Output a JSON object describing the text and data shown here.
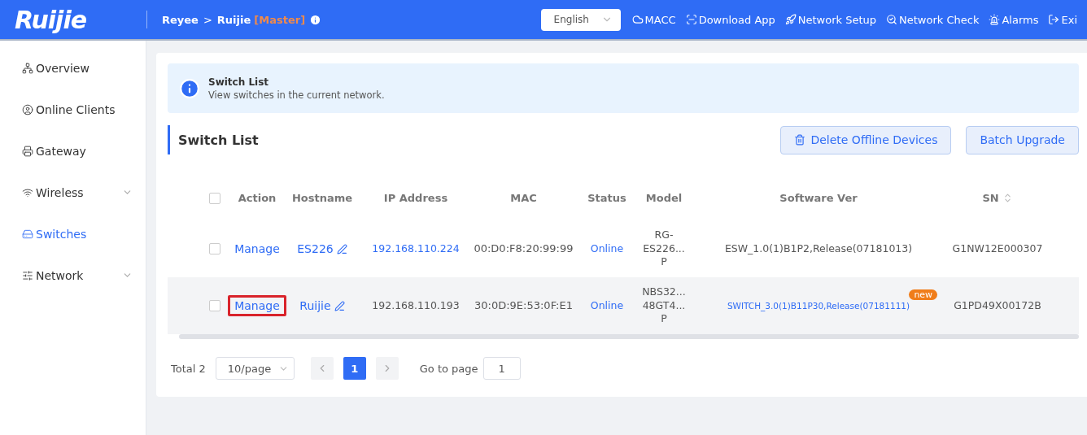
{
  "header": {
    "logo": "Ruijie",
    "breadcrumb": [
      {
        "label": "Reyee"
      },
      {
        "label": "Ruijie"
      }
    ],
    "separator": ">",
    "role": "[Master]",
    "language": {
      "value": "English"
    },
    "nav": [
      {
        "label": "MACC"
      },
      {
        "label": "Download App"
      },
      {
        "label": "Network Setup"
      },
      {
        "label": "Network Check"
      },
      {
        "label": "Alarms"
      },
      {
        "label": "Exi"
      }
    ]
  },
  "sidebar": {
    "items": [
      {
        "label": "Overview",
        "selected": false,
        "expandable": false
      },
      {
        "label": "Online Clients",
        "selected": false,
        "expandable": false
      },
      {
        "label": "Gateway",
        "selected": false,
        "expandable": false
      },
      {
        "label": "Wireless",
        "selected": false,
        "expandable": true
      },
      {
        "label": "Switches",
        "selected": true,
        "expandable": false
      },
      {
        "label": "Network",
        "selected": false,
        "expandable": true
      }
    ]
  },
  "banner": {
    "title": "Switch List",
    "text": "View switches in the current network."
  },
  "section": {
    "title": "Switch List",
    "buttons": [
      {
        "label": "Delete Offline Devices"
      },
      {
        "label": "Batch Upgrade"
      }
    ]
  },
  "table": {
    "all_checked": false,
    "columns": [
      {
        "label": "Action",
        "sortable": false
      },
      {
        "label": "Hostname",
        "sortable": false
      },
      {
        "label": "IP Address",
        "sortable": false
      },
      {
        "label": "MAC",
        "sortable": false
      },
      {
        "label": "Status",
        "sortable": false
      },
      {
        "label": "Model",
        "sortable": false
      },
      {
        "label": "Software Ver",
        "sortable": false
      },
      {
        "label": "SN",
        "sortable": true
      }
    ],
    "rows": [
      {
        "checked": false,
        "hovered": false,
        "action": "Manage",
        "action_highlighted": false,
        "hostname": "ES226",
        "ip": "192.168.110.224",
        "ip_link": true,
        "mac": "00:D0:F8:20:99:99",
        "status": "Online",
        "model": "RG-\nES226...\nP",
        "software": "ESW_1.0(1)B1P2,Release(07181013)",
        "software_link": false,
        "sn": "G1NW12E000307"
      },
      {
        "checked": false,
        "hovered": true,
        "action": "Manage",
        "action_highlighted": true,
        "hostname": "Ruijie",
        "ip": "192.168.110.193",
        "ip_link": false,
        "mac": "30:0D:9E:53:0F:E1",
        "status": "Online",
        "model": "NBS32...\n48GT4...\nP",
        "software": "SWITCH_3.0(1)B11P30,Release(07181111)",
        "software_link": true,
        "badge": "new",
        "sn": "G1PD49X00172B"
      }
    ]
  },
  "pagination": {
    "total": "Total 2",
    "page_size": "10/page",
    "pages": [
      {
        "label": "1",
        "selected": true
      }
    ],
    "goto_label": "Go to page",
    "goto_value": "1"
  }
}
